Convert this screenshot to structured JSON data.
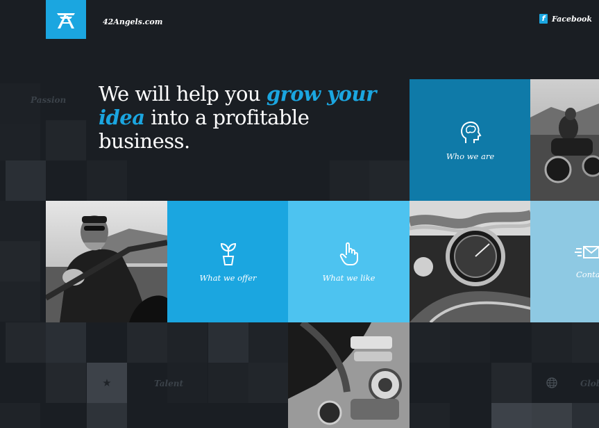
{
  "header": {
    "site_name": "42Angels.com",
    "facebook_label": "Facebook",
    "facebook_icon": "f"
  },
  "hero": {
    "pre": "We will help you ",
    "highlight": "grow your idea",
    "post": " into a profitable business."
  },
  "background_labels": {
    "passion": "Passion",
    "talent": "Talent",
    "global": "Glob"
  },
  "tiles": {
    "who_we_are": "Who we are",
    "what_we_offer": "What we offer",
    "what_we_like": "What we like",
    "contact": "Contact"
  },
  "colors": {
    "background": "#1a1e23",
    "brand_blue": "#1ba6e0",
    "deep_blue": "#0f7aa8",
    "light_blue": "#4dc3f0",
    "pale_blue": "#8ec9e3"
  }
}
